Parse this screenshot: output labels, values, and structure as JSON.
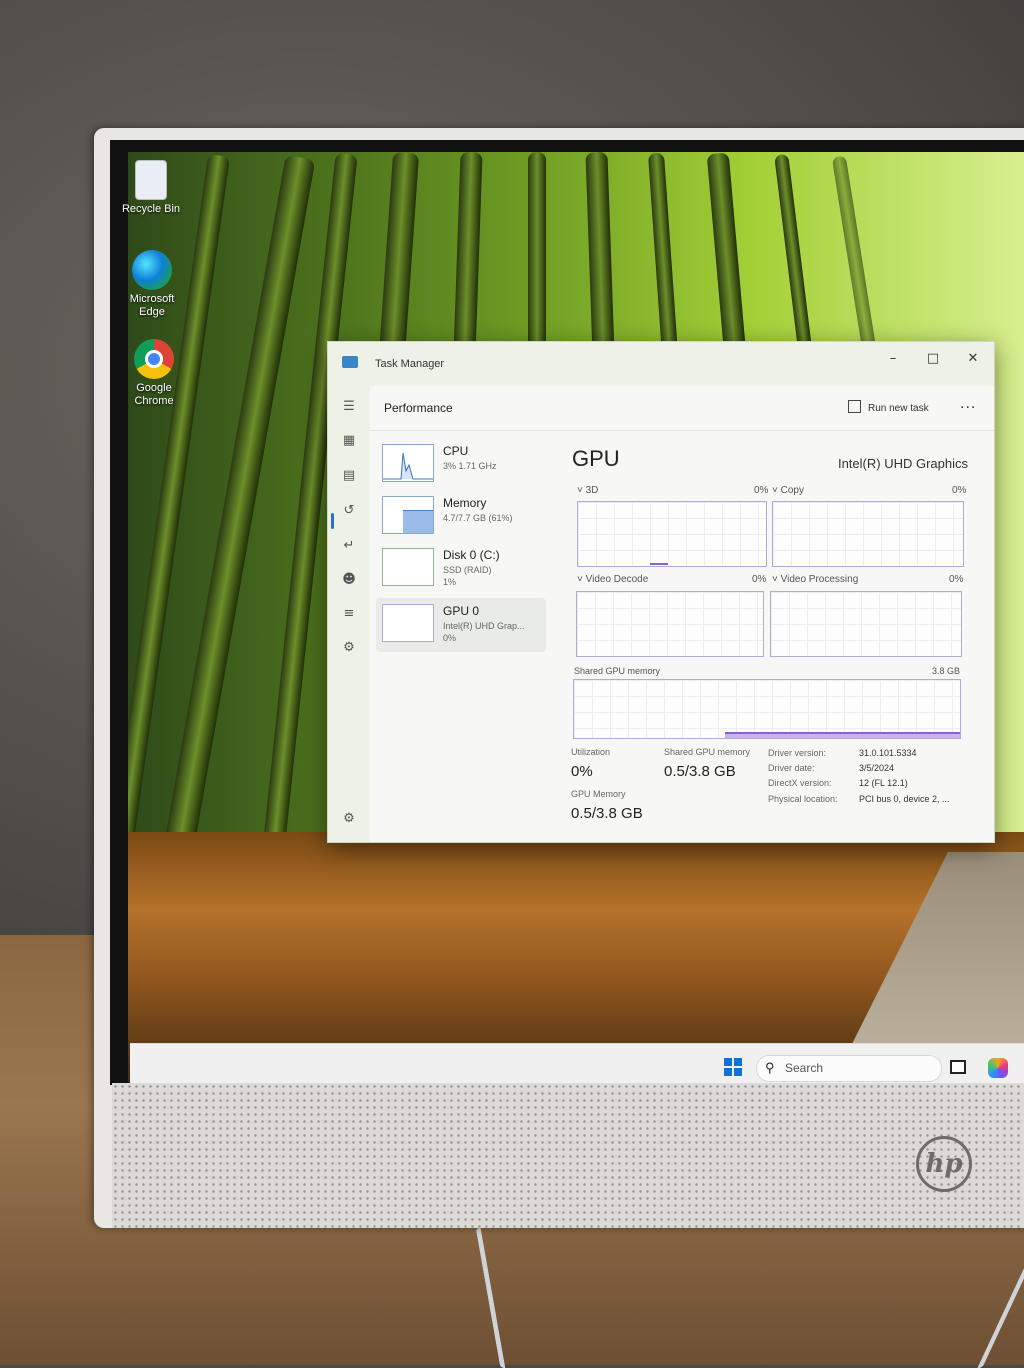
{
  "desktop": {
    "icons": [
      {
        "label": "Recycle Bin"
      },
      {
        "label": "Microsoft Edge"
      },
      {
        "label": "Google Chrome"
      }
    ]
  },
  "taskbar": {
    "search_placeholder": "Search"
  },
  "task_manager": {
    "window_title": "Task Manager",
    "header": "Performance",
    "run_new_task": "Run new task",
    "more": "...",
    "devices": [
      {
        "name": "CPU",
        "detail1": "3% 1.71 GHz",
        "detail2": ""
      },
      {
        "name": "Memory",
        "detail1": "4.7/7.7 GB (61%)",
        "detail2": ""
      },
      {
        "name": "Disk 0 (C:)",
        "detail1": "SSD (RAID)",
        "detail2": "1%"
      },
      {
        "name": "GPU 0",
        "detail1": "Intel(R) UHD Grap...",
        "detail2": "0%"
      }
    ],
    "gpu": {
      "title": "GPU",
      "adapter": "Intel(R) UHD Graphics",
      "engines": [
        {
          "name": "3D",
          "value": "0%"
        },
        {
          "name": "Copy",
          "value": "0%"
        },
        {
          "name": "Video Decode",
          "value": "0%"
        },
        {
          "name": "Video Processing",
          "value": "0%"
        }
      ],
      "shared_memory_label": "Shared GPU memory",
      "shared_memory_max": "3.8 GB",
      "shared_memory_fill": 0.13,
      "stats": {
        "utilization_label": "Utilization",
        "utilization_value": "0%",
        "shared_label": "Shared GPU memory",
        "shared_value": "0.5/3.8 GB",
        "gpu_mem_label": "GPU Memory",
        "gpu_mem_value": "0.5/3.8 GB"
      },
      "info": [
        {
          "key": "Driver version:",
          "value": "31.0.101.5334"
        },
        {
          "key": "Driver date:",
          "value": "3/5/2024"
        },
        {
          "key": "DirectX version:",
          "value": "12 (FL 12.1)"
        },
        {
          "key": "Physical location:",
          "value": "PCI bus 0, device 2, ..."
        }
      ]
    }
  },
  "brand": {
    "logo_text": "hp"
  }
}
